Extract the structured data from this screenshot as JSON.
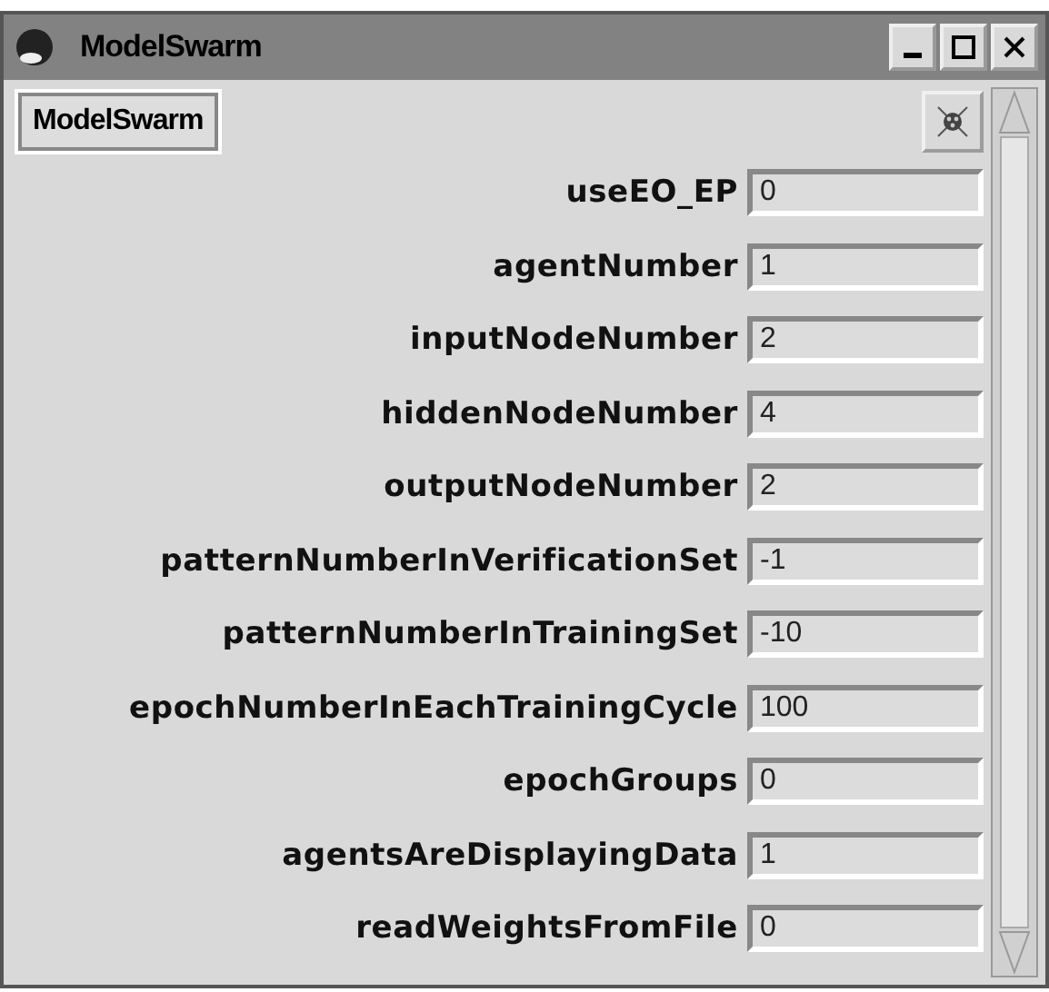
{
  "window": {
    "title": "ModelSwarm"
  },
  "header_button": "ModelSwarm",
  "fields": [
    {
      "label": "useEO_EP",
      "value": "0"
    },
    {
      "label": "agentNumber",
      "value": "1"
    },
    {
      "label": "inputNodeNumber",
      "value": "2"
    },
    {
      "label": "hiddenNodeNumber",
      "value": "4"
    },
    {
      "label": "outputNodeNumber",
      "value": "2"
    },
    {
      "label": "patternNumberInVerificationSet",
      "value": "-1"
    },
    {
      "label": "patternNumberInTrainingSet",
      "value": "-10"
    },
    {
      "label": "epochNumberInEachTrainingCycle",
      "value": "100"
    },
    {
      "label": "epochGroups",
      "value": "0"
    },
    {
      "label": "agentsAreDisplayingData",
      "value": "1"
    },
    {
      "label": "readWeightsFromFile",
      "value": "0"
    }
  ]
}
